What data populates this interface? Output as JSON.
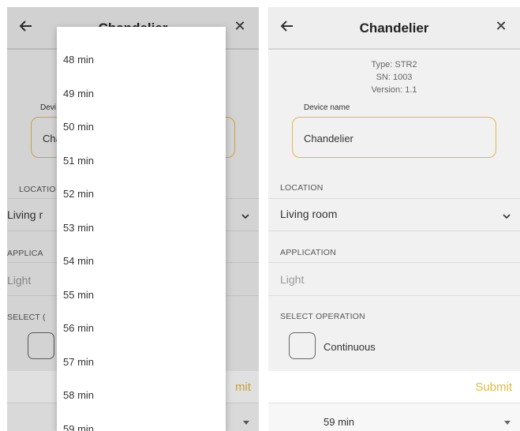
{
  "screen": {
    "title": "Chandelier",
    "info": [
      "Type: STR2",
      "SN: 1003",
      "Version: 1.1"
    ],
    "device_name_label": "Device name",
    "device_name_value": "Chandelier",
    "location_label": "LOCATION",
    "location_value": "Living room",
    "application_label": "APPLICATION",
    "application_value": "Light",
    "select_operation_label": "SELECT OPERATION",
    "operation_option": "Continuous",
    "submit_label": "Submit",
    "duration_value": "59 min",
    "accent_color": "#e0b84a",
    "icons": [
      "arrow-left-icon",
      "close-icon",
      "chevron-down-icon",
      "caret-down-icon"
    ]
  },
  "left_partial": {
    "title_visible": "Chandelier",
    "device_label_visible": "Devi",
    "device_value_visible": "Cha",
    "location_label_visible": "LOCATIO",
    "location_value_visible": "Living r",
    "application_label_visible": "APPLICA",
    "application_value_visible": "Light",
    "select_label_visible": "SELECT (",
    "submit_visible": "mit"
  },
  "dropdown": {
    "options": [
      "48 min",
      "49 min",
      "50 min",
      "51 min",
      "52 min",
      "53 min",
      "54 min",
      "55 min",
      "56 min",
      "57 min",
      "58 min",
      "59 min"
    ]
  }
}
